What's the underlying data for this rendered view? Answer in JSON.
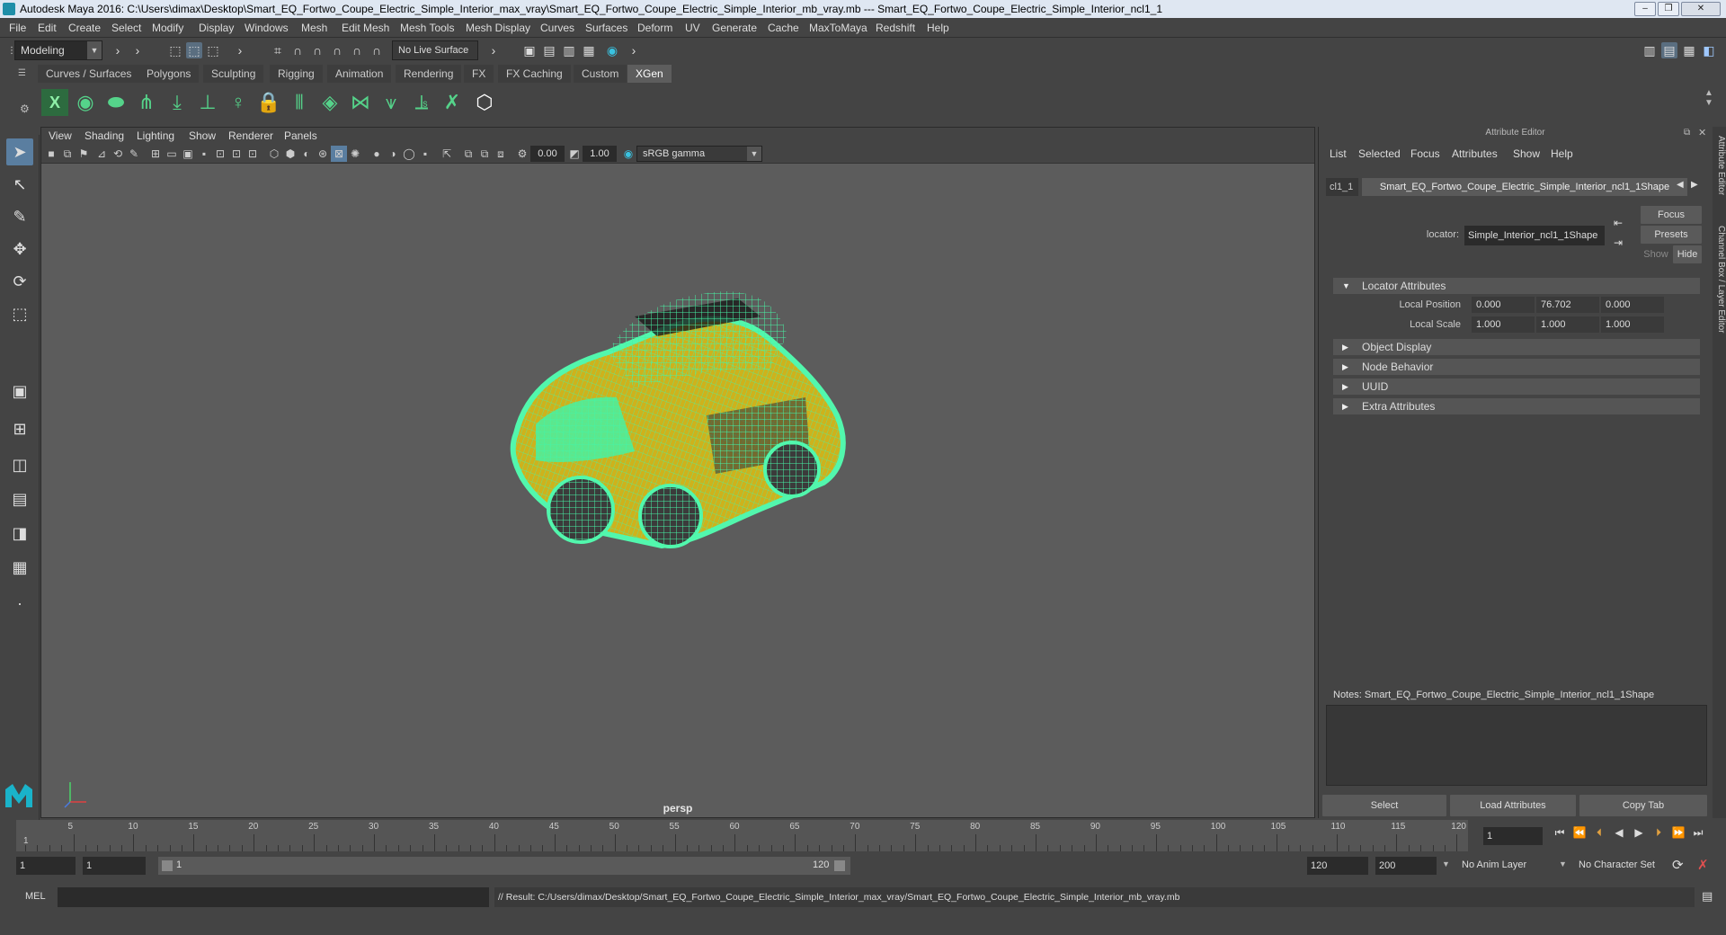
{
  "window": {
    "title": "Autodesk Maya 2016: C:\\Users\\dimax\\Desktop\\Smart_EQ_Fortwo_Coupe_Electric_Simple_Interior_max_vray\\Smart_EQ_Fortwo_Coupe_Electric_Simple_Interior_mb_vray.mb   ---   Smart_EQ_Fortwo_Coupe_Electric_Simple_Interior_ncl1_1"
  },
  "menubar": [
    "File",
    "Edit",
    "Create",
    "Select",
    "Modify",
    "Display",
    "Windows",
    "Mesh",
    "Edit Mesh",
    "Mesh Tools",
    "Mesh Display",
    "Curves",
    "Surfaces",
    "Deform",
    "UV",
    "Generate",
    "Cache",
    "MaxToMaya",
    "Redshift",
    "Help"
  ],
  "status": {
    "mode": "Modeling",
    "live_surface": "No Live Surface"
  },
  "shelf_tabs": [
    "Curves / Surfaces",
    "Polygons",
    "Sculpting",
    "Rigging",
    "Animation",
    "Rendering",
    "FX",
    "FX Caching",
    "Custom",
    "XGen"
  ],
  "shelf_active": "XGen",
  "viewport": {
    "menu": [
      "View",
      "Shading",
      "Lighting",
      "Show",
      "Renderer",
      "Panels"
    ],
    "exposure": "0.00",
    "gamma": "1.00",
    "color_space": "sRGB gamma",
    "camera_label": "persp",
    "wire_color": "#49f0a0",
    "body_color": "#d8b51a"
  },
  "attribute_editor": {
    "title": "Attribute Editor",
    "menu": [
      "List",
      "Selected",
      "Focus",
      "Attributes",
      "Show",
      "Help"
    ],
    "tab_left": "cl1_1",
    "tab_right": "Smart_EQ_Fortwo_Coupe_Electric_Simple_Interior_ncl1_1Shape",
    "locator_label": "locator:",
    "locator_value": "Simple_Interior_ncl1_1Shape",
    "focus": "Focus",
    "presets": "Presets",
    "show": "Show",
    "hide": "Hide",
    "sections": {
      "locator": "Locator Attributes",
      "object_display": "Object Display",
      "node_behavior": "Node Behavior",
      "uuid": "UUID",
      "extra": "Extra Attributes"
    },
    "local_position_label": "Local Position",
    "local_position": [
      "0.000",
      "76.702",
      "0.000"
    ],
    "local_scale_label": "Local Scale",
    "local_scale": [
      "1.000",
      "1.000",
      "1.000"
    ],
    "notes_label": "Notes:  Smart_EQ_Fortwo_Coupe_Electric_Simple_Interior_ncl1_1Shape",
    "buttons": {
      "select": "Select",
      "load": "Load Attributes",
      "copy": "Copy Tab"
    }
  },
  "side_tabs": {
    "attr": "Attribute Editor",
    "channel": "Channel Box / Layer Editor"
  },
  "timeline": {
    "ticks": [
      "5",
      "10",
      "15",
      "20",
      "25",
      "30",
      "35",
      "40",
      "45",
      "50",
      "55",
      "60",
      "65",
      "70",
      "75",
      "80",
      "85",
      "90",
      "95",
      "100",
      "105",
      "110",
      "115",
      "120"
    ],
    "first": "1",
    "current_frame": "1"
  },
  "range": {
    "start": "1",
    "start2": "1",
    "slider_start": "1",
    "slider_end": "120",
    "end": "120",
    "end2": "200",
    "anim_layer": "No Anim Layer",
    "char_set": "No Character Set"
  },
  "command": {
    "lang": "MEL",
    "result": "// Result: C:/Users/dimax/Desktop/Smart_EQ_Fortwo_Coupe_Electric_Simple_Interior_max_vray/Smart_EQ_Fortwo_Coupe_Electric_Simple_Interior_mb_vray.mb"
  }
}
